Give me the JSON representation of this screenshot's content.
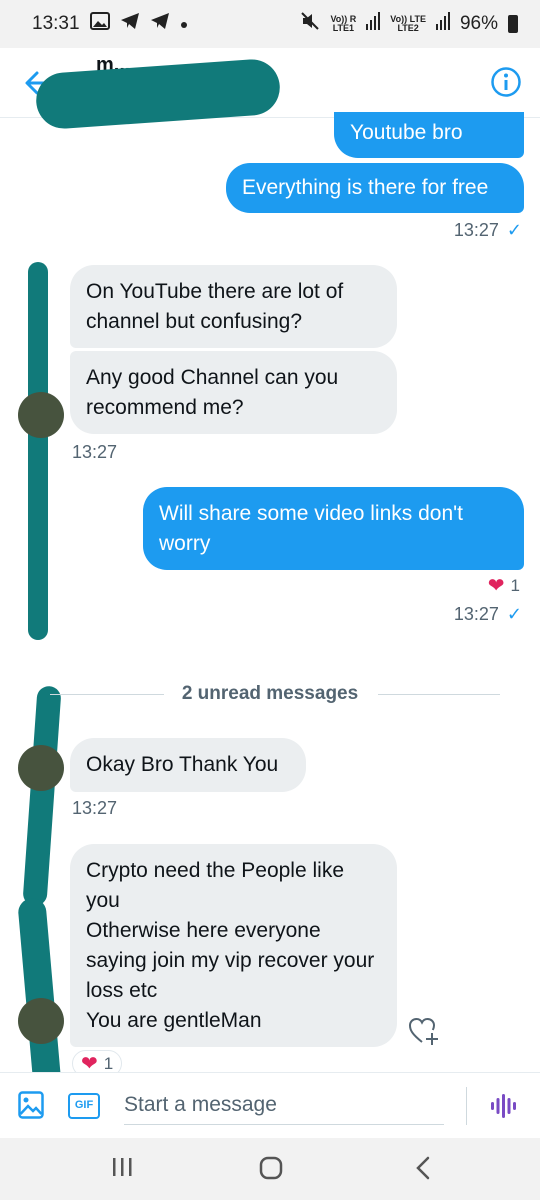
{
  "status_bar": {
    "time": "13:31",
    "net1_top": "Vo)) R",
    "net1_bottom": "LTE1",
    "net2_top": "Vo)) LTE",
    "net2_bottom": "LTE2",
    "battery": "96%"
  },
  "header": {
    "name": "m..."
  },
  "messages": [
    {
      "id": "m1",
      "direction": "out",
      "text": "Youtube bro"
    },
    {
      "id": "m2",
      "direction": "out",
      "text": "Everything is there for free"
    },
    {
      "id": "m3",
      "direction": "in",
      "text": "On YouTube there are lot of channel but confusing?"
    },
    {
      "id": "m4",
      "direction": "in",
      "text": "Any good Channel can you recommend me?"
    },
    {
      "id": "m5",
      "direction": "out",
      "text": "Will share some video links don't worry"
    },
    {
      "id": "m6",
      "direction": "in",
      "text": "Okay Bro Thank You"
    },
    {
      "id": "m7",
      "direction": "in",
      "text": "Crypto need the People like you\nOtherwise here everyone saying join my vip recover your loss etc\nYou are gentleMan"
    }
  ],
  "timestamps": {
    "t1": "13:27",
    "t2": "13:27",
    "t3": "13:27",
    "t4": "13:27"
  },
  "reactions": {
    "r1": {
      "emoji": "❤",
      "count": "1"
    },
    "r2": {
      "emoji": "❤",
      "count": "1"
    }
  },
  "divider": {
    "label": "2 unread messages"
  },
  "composer": {
    "placeholder": "Start a message",
    "gif_label": "GIF"
  },
  "colors": {
    "accent": "#1d9bf0",
    "incoming_bubble": "#ebeef0",
    "heart": "#e0245e",
    "redaction": "#117a7a"
  },
  "icons": [
    "back-arrow-icon",
    "info-icon",
    "image-icon",
    "gif-icon",
    "voice-icon",
    "add-reaction-icon",
    "recents-icon",
    "home-icon",
    "back-nav-icon"
  ]
}
